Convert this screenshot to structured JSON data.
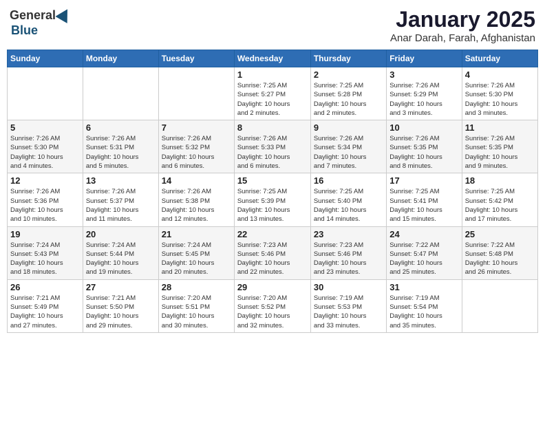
{
  "header": {
    "logo_general": "General",
    "logo_blue": "Blue",
    "title": "January 2025",
    "subtitle": "Anar Darah, Farah, Afghanistan"
  },
  "calendar": {
    "weekdays": [
      "Sunday",
      "Monday",
      "Tuesday",
      "Wednesday",
      "Thursday",
      "Friday",
      "Saturday"
    ],
    "rows": [
      [
        {
          "day": "",
          "info": ""
        },
        {
          "day": "",
          "info": ""
        },
        {
          "day": "",
          "info": ""
        },
        {
          "day": "1",
          "info": "Sunrise: 7:25 AM\nSunset: 5:27 PM\nDaylight: 10 hours\nand 2 minutes."
        },
        {
          "day": "2",
          "info": "Sunrise: 7:25 AM\nSunset: 5:28 PM\nDaylight: 10 hours\nand 2 minutes."
        },
        {
          "day": "3",
          "info": "Sunrise: 7:26 AM\nSunset: 5:29 PM\nDaylight: 10 hours\nand 3 minutes."
        },
        {
          "day": "4",
          "info": "Sunrise: 7:26 AM\nSunset: 5:30 PM\nDaylight: 10 hours\nand 3 minutes."
        }
      ],
      [
        {
          "day": "5",
          "info": "Sunrise: 7:26 AM\nSunset: 5:30 PM\nDaylight: 10 hours\nand 4 minutes."
        },
        {
          "day": "6",
          "info": "Sunrise: 7:26 AM\nSunset: 5:31 PM\nDaylight: 10 hours\nand 5 minutes."
        },
        {
          "day": "7",
          "info": "Sunrise: 7:26 AM\nSunset: 5:32 PM\nDaylight: 10 hours\nand 6 minutes."
        },
        {
          "day": "8",
          "info": "Sunrise: 7:26 AM\nSunset: 5:33 PM\nDaylight: 10 hours\nand 6 minutes."
        },
        {
          "day": "9",
          "info": "Sunrise: 7:26 AM\nSunset: 5:34 PM\nDaylight: 10 hours\nand 7 minutes."
        },
        {
          "day": "10",
          "info": "Sunrise: 7:26 AM\nSunset: 5:35 PM\nDaylight: 10 hours\nand 8 minutes."
        },
        {
          "day": "11",
          "info": "Sunrise: 7:26 AM\nSunset: 5:35 PM\nDaylight: 10 hours\nand 9 minutes."
        }
      ],
      [
        {
          "day": "12",
          "info": "Sunrise: 7:26 AM\nSunset: 5:36 PM\nDaylight: 10 hours\nand 10 minutes."
        },
        {
          "day": "13",
          "info": "Sunrise: 7:26 AM\nSunset: 5:37 PM\nDaylight: 10 hours\nand 11 minutes."
        },
        {
          "day": "14",
          "info": "Sunrise: 7:26 AM\nSunset: 5:38 PM\nDaylight: 10 hours\nand 12 minutes."
        },
        {
          "day": "15",
          "info": "Sunrise: 7:25 AM\nSunset: 5:39 PM\nDaylight: 10 hours\nand 13 minutes."
        },
        {
          "day": "16",
          "info": "Sunrise: 7:25 AM\nSunset: 5:40 PM\nDaylight: 10 hours\nand 14 minutes."
        },
        {
          "day": "17",
          "info": "Sunrise: 7:25 AM\nSunset: 5:41 PM\nDaylight: 10 hours\nand 15 minutes."
        },
        {
          "day": "18",
          "info": "Sunrise: 7:25 AM\nSunset: 5:42 PM\nDaylight: 10 hours\nand 17 minutes."
        }
      ],
      [
        {
          "day": "19",
          "info": "Sunrise: 7:24 AM\nSunset: 5:43 PM\nDaylight: 10 hours\nand 18 minutes."
        },
        {
          "day": "20",
          "info": "Sunrise: 7:24 AM\nSunset: 5:44 PM\nDaylight: 10 hours\nand 19 minutes."
        },
        {
          "day": "21",
          "info": "Sunrise: 7:24 AM\nSunset: 5:45 PM\nDaylight: 10 hours\nand 20 minutes."
        },
        {
          "day": "22",
          "info": "Sunrise: 7:23 AM\nSunset: 5:46 PM\nDaylight: 10 hours\nand 22 minutes."
        },
        {
          "day": "23",
          "info": "Sunrise: 7:23 AM\nSunset: 5:46 PM\nDaylight: 10 hours\nand 23 minutes."
        },
        {
          "day": "24",
          "info": "Sunrise: 7:22 AM\nSunset: 5:47 PM\nDaylight: 10 hours\nand 25 minutes."
        },
        {
          "day": "25",
          "info": "Sunrise: 7:22 AM\nSunset: 5:48 PM\nDaylight: 10 hours\nand 26 minutes."
        }
      ],
      [
        {
          "day": "26",
          "info": "Sunrise: 7:21 AM\nSunset: 5:49 PM\nDaylight: 10 hours\nand 27 minutes."
        },
        {
          "day": "27",
          "info": "Sunrise: 7:21 AM\nSunset: 5:50 PM\nDaylight: 10 hours\nand 29 minutes."
        },
        {
          "day": "28",
          "info": "Sunrise: 7:20 AM\nSunset: 5:51 PM\nDaylight: 10 hours\nand 30 minutes."
        },
        {
          "day": "29",
          "info": "Sunrise: 7:20 AM\nSunset: 5:52 PM\nDaylight: 10 hours\nand 32 minutes."
        },
        {
          "day": "30",
          "info": "Sunrise: 7:19 AM\nSunset: 5:53 PM\nDaylight: 10 hours\nand 33 minutes."
        },
        {
          "day": "31",
          "info": "Sunrise: 7:19 AM\nSunset: 5:54 PM\nDaylight: 10 hours\nand 35 minutes."
        },
        {
          "day": "",
          "info": ""
        }
      ]
    ]
  }
}
